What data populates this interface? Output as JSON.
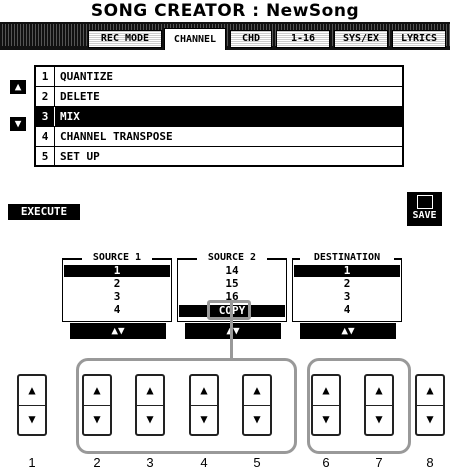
{
  "title": "SONG CREATOR : NewSong",
  "tabs": [
    "REC MODE",
    "CHANNEL",
    "CHD",
    "1-16",
    "SYS/EX",
    "LYRICS"
  ],
  "active_tab": "CHANNEL",
  "menu_items": [
    {
      "num": "1",
      "label": "QUANTIZE"
    },
    {
      "num": "2",
      "label": "DELETE"
    },
    {
      "num": "3",
      "label": "MIX"
    },
    {
      "num": "4",
      "label": "CHANNEL TRANSPOSE"
    },
    {
      "num": "5",
      "label": "SET UP"
    }
  ],
  "selected_menu": "MIX",
  "scroll_up_icon": "triangle-up-icon",
  "scroll_down_icon": "triangle-down-icon",
  "execute_label": "EXECUTE",
  "save_label": "SAVE",
  "source1": {
    "label": "SOURCE 1",
    "selected": "1",
    "items": [
      "2",
      "3",
      "4"
    ]
  },
  "source2": {
    "label": "SOURCE 2",
    "items": [
      "14",
      "15",
      "16"
    ],
    "selected": "COPY"
  },
  "destination": {
    "label": "DESTINATION",
    "selected": "1",
    "items": [
      "2",
      "3",
      "4"
    ]
  },
  "updown_label": "▲▼",
  "hw_buttons": [
    "1",
    "2",
    "3",
    "4",
    "5",
    "6",
    "7",
    "8"
  ],
  "colors": {
    "lcd_bg": "#ffffff",
    "lcd_fg": "#000000",
    "callout": "#999999"
  }
}
